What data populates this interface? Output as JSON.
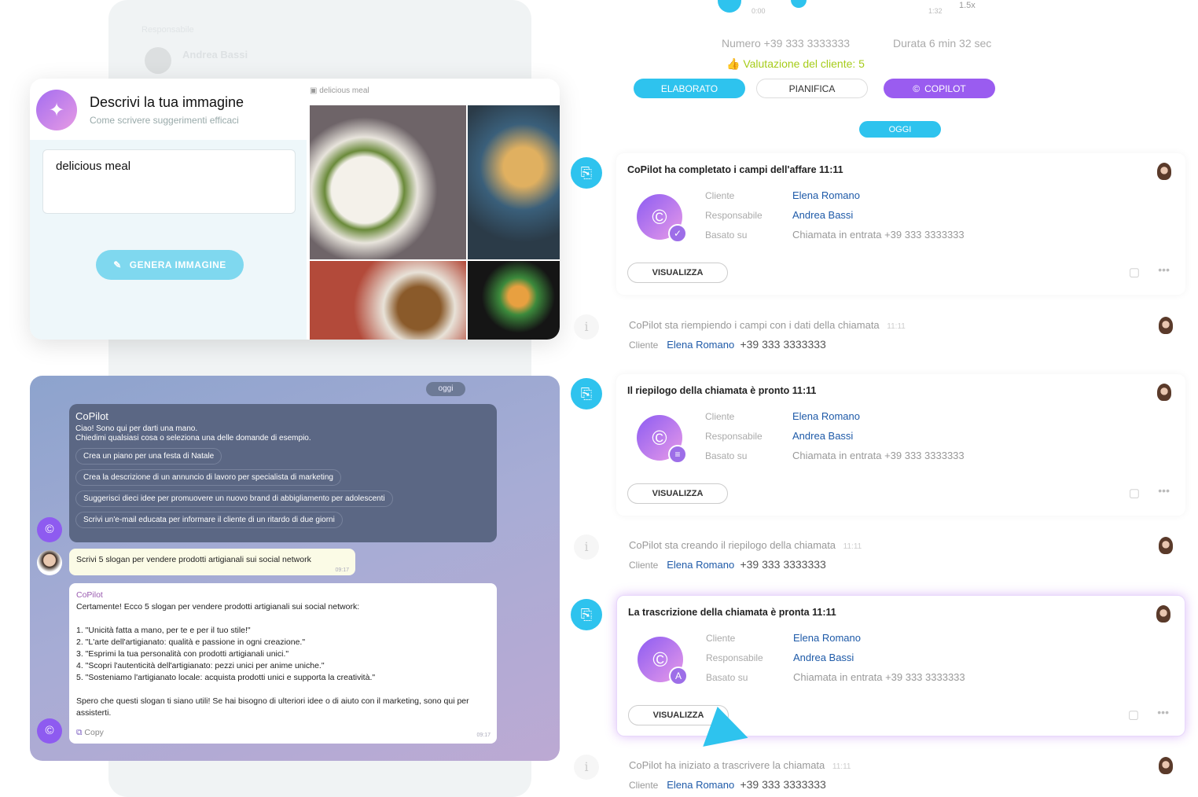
{
  "background_panel": {
    "label": "Responsabile",
    "name": "Andrea Bassi"
  },
  "image_gen": {
    "title": "Descrivi la tua immagine",
    "subtitle": "Come scrivere suggerimenti efficaci",
    "prompt": "delicious meal",
    "button": "GENERA IMMAGINE",
    "result_label": "delicious meal"
  },
  "chat": {
    "date": "oggi",
    "copilot_name": "CoPilot",
    "greeting": [
      "Ciao! Sono qui per darti una mano.",
      "Chiedimi qualsiasi cosa o seleziona una delle domande di esempio."
    ],
    "suggestions": [
      "Crea un piano per una festa di Natale",
      "Crea la descrizione di un annuncio di lavoro per specialista di marketing",
      "Suggerisci dieci idee per promuovere un nuovo brand di abbigliamento per adolescenti",
      "Scrivi un'e-mail educata per informare il cliente di un ritardo di due giorni"
    ],
    "user_message": "Scrivi 5 slogan per vendere prodotti artigianali sui social network",
    "user_time": "09:17",
    "reply": {
      "sender": "CoPilot",
      "intro": "Certamente! Ecco 5 slogan per vendere prodotti artigianali sui social network:",
      "lines": [
        "1. \"Unicità fatta a mano, per te e per il tuo stile!\"",
        "2. \"L'arte dell'artigianato: qualità e passione in ogni creazione.\"",
        "3. \"Esprimi la tua personalità con prodotti artigianali unici.\"",
        "4. \"Scopri l'autenticità dell'artigianato: pezzi unici per anime uniche.\"",
        "5. \"Sosteniamo l'artigianato locale: acquista prodotti unici e supporta la creatività.\""
      ],
      "outro": "Spero che questi slogan ti siano utili! Se hai bisogno di ulteriori idee o di aiuto con il marketing, sono qui per assisterti.",
      "copy": "Copy",
      "time": "09:17"
    }
  },
  "call": {
    "time_start": "0:00",
    "time_end": "1:32",
    "speed": "1.5x",
    "number": "Numero +39 333 3333333",
    "duration": "Durata 6 min 32 sec",
    "rating": "Valutazione del cliente: 5",
    "buttons": {
      "elaborato": "ELABORATO",
      "pianifica": "PIANIFICA",
      "copilot": "COPILOT"
    },
    "today": "OGGI"
  },
  "labels": {
    "cliente": "Cliente",
    "responsabile": "Responsabile",
    "basato": "Basato su",
    "view": "VISUALIZZA"
  },
  "cards": [
    {
      "title": "CoPilot ha completato i campi dell'affare 11:11",
      "cliente": "Elena Romano",
      "responsabile": "Andrea Bassi",
      "basato": "Chiamata in entrata +39 333 3333333"
    },
    {
      "title": "Il riepilogo della chiamata è pronto 11:11",
      "cliente": "Elena Romano",
      "responsabile": "Andrea Bassi",
      "basato": "Chiamata in entrata +39 333 3333333"
    },
    {
      "title": "La trascrizione della chiamata è pronta 11:11",
      "cliente": "Elena Romano",
      "responsabile": "Andrea Bassi",
      "basato": "Chiamata in entrata +39 333 3333333"
    }
  ],
  "events": [
    {
      "text": "CoPilot sta riempiendo i campi con i dati della chiamata",
      "time": "11:11",
      "cliente": "Elena Romano",
      "phone": "+39 333 3333333"
    },
    {
      "text": "CoPilot sta creando il riepilogo della chiamata",
      "time": "11:11",
      "cliente": "Elena Romano",
      "phone": "+39 333 3333333"
    },
    {
      "text": "CoPilot ha iniziato a trascrivere la chiamata",
      "time": "11:11",
      "cliente": "Elena Romano",
      "phone": "+39 333 3333333"
    }
  ],
  "colors": {
    "accent": "#2ec3ee",
    "copilot": "#9a5cf0",
    "link": "#1e5aa8",
    "rating": "#a6cc1a"
  }
}
